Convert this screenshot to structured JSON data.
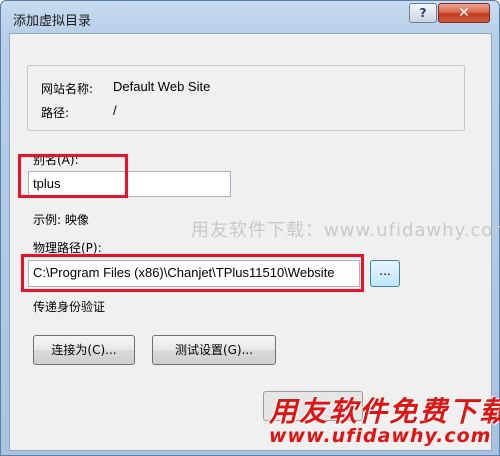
{
  "window": {
    "title": "添加虚拟目录",
    "help_label": "?",
    "close_label": "✕"
  },
  "site_info": {
    "site_name_label": "网站名称:",
    "site_name_value": "Default Web Site",
    "path_label": "路径:",
    "path_value": "/"
  },
  "alias": {
    "label": "别名(A):",
    "value": "tplus"
  },
  "example": {
    "text": "示例: 映像"
  },
  "physical_path": {
    "label": "物理路径(P):",
    "value": "C:\\Program Files (x86)\\Chanjet\\TPlus11510\\Website",
    "browse_label": "..."
  },
  "pass_through": {
    "label": "传递身份验证"
  },
  "buttons": {
    "connect_as": "连接为(C)...",
    "test_settings": "测试设置(G)..."
  },
  "watermarks": {
    "middle": "用友软件下载：www.ufidawhy.com",
    "big_title": "用友软件免费下载",
    "big_url": "www.ufidawhy.com"
  },
  "colors": {
    "highlight_box": "#e8132a",
    "watermark_red": "#e11414",
    "title_bar": "#b7cfe8"
  }
}
